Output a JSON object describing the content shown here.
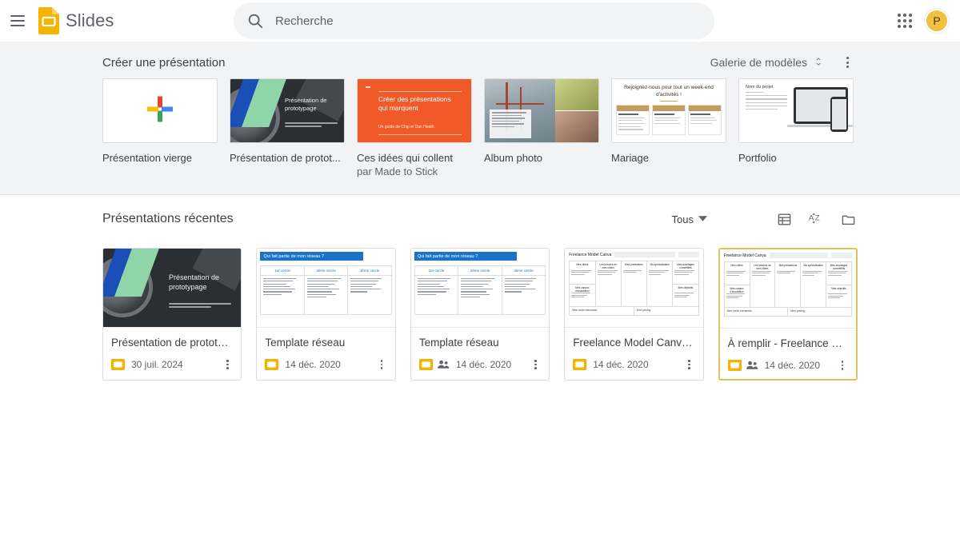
{
  "header": {
    "menu_icon": "hamburger-menu-icon",
    "logo_icon": "google-slides-logo-icon",
    "brand": "Slides",
    "search": {
      "icon": "search-icon",
      "placeholder": "Recherche",
      "value": ""
    },
    "apps_icon": "google-apps-grid-icon",
    "avatar_initial": "P",
    "avatar_color": "#f0c040"
  },
  "create_section": {
    "title": "Créer une présentation",
    "gallery_label": "Galerie de modèles",
    "gallery_chevron_icon": "unfold-more-icon",
    "more_icon": "more-vert-icon",
    "templates": [
      {
        "name": "Présentation vierge",
        "sub": "",
        "thumb": "blank-plus-thumb"
      },
      {
        "name": "Présentation de protot...",
        "sub": "",
        "thumb": "prototypage-thumb",
        "slide_title": "Présentation de prototypage"
      },
      {
        "name": "Ces idées qui collent",
        "sub": "par Made to Stick",
        "thumb": "ideas-thumb",
        "slide_title": "Créer des présentations qui marquent",
        "slide_sub": "Un guide de Chip et Dan Heath"
      },
      {
        "name": "Album photo",
        "sub": "",
        "thumb": "album-photo-thumb"
      },
      {
        "name": "Mariage",
        "sub": "",
        "thumb": "wedding-thumb",
        "slide_title": "Rejoignez-nous pour tout un week-end d'activités !",
        "columns": [
          "Vendredi",
          "Samedi",
          "Dimanche"
        ]
      },
      {
        "name": "Portfolio",
        "sub": "",
        "thumb": "portfolio-thumb",
        "slide_title": "Nom du projet"
      }
    ]
  },
  "recent_section": {
    "title": "Présentations récentes",
    "filter_label": "Tous",
    "filter_chevron_icon": "arrow-drop-down-icon",
    "view_icons": [
      "list-view-icon",
      "sort-az-icon",
      "folder-icon"
    ],
    "cards": [
      {
        "title": "Présentation de prototyp...",
        "date": "30 juil. 2024",
        "shared": false,
        "selected": false,
        "thumb": "prototypage-thumb",
        "slide_title": "Présentation de prototypage"
      },
      {
        "title": "Template réseau",
        "date": "14 déc. 2020",
        "shared": false,
        "selected": false,
        "thumb": "network-thumb",
        "slide_title": "Qui fait partie de mon réseau ?",
        "columns": [
          "1er cercle",
          "2ème cercle",
          "3ème cercle"
        ]
      },
      {
        "title": "Template réseau",
        "date": "14 déc. 2020",
        "shared": true,
        "selected": false,
        "thumb": "network-thumb",
        "slide_title": "Qui fait partie de mon réseau ?",
        "columns": [
          "1er cercle",
          "2ème cercle",
          "3ème cercle"
        ]
      },
      {
        "title": "Freelance Model Canva • ...",
        "date": "14 déc. 2020",
        "shared": false,
        "selected": false,
        "thumb": "canvas-thumb",
        "slide_title": "Freelance Model Canva",
        "cells": [
          "Mes cibles",
          "Les besoins de mes cibles",
          "Mes prestations",
          "Ma spécialisation",
          "Mes avantages compétitifs",
          "Mes canaux d'acquisition",
          "Mes objectifs",
          "Mes coûts mensuels",
          "Mon pricing"
        ]
      },
      {
        "title": "À remplir - Freelance Mo...",
        "date": "14 déc. 2020",
        "shared": true,
        "selected": true,
        "thumb": "canvas-thumb",
        "slide_title": "Freelance Model Canva",
        "cells": [
          "Mes cibles",
          "Les besoins de mes cibles",
          "Mes prestations",
          "Ma spécialisation",
          "Mes avantages compétitifs",
          "Mes canaux d'acquisition",
          "Mes objectifs",
          "Mes coûts mensuels",
          "Mon pricing"
        ]
      }
    ]
  },
  "colors": {
    "slides_yellow": "#f4b400",
    "selected_border": "#dfc45d",
    "section_bg": "#f1f3f4",
    "accent_blue": "#1a73c8"
  }
}
